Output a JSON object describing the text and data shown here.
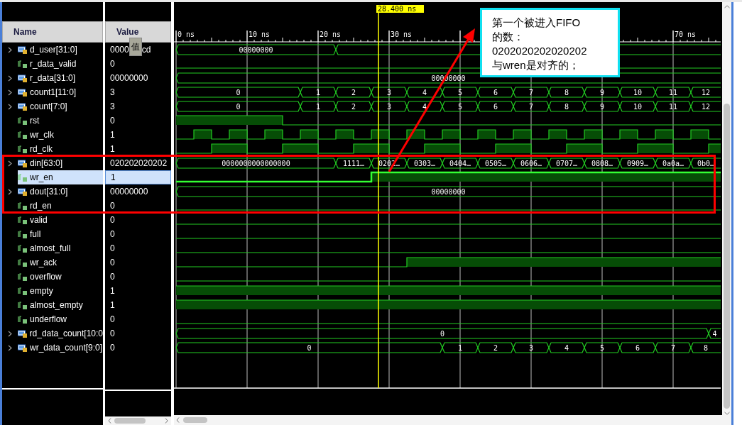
{
  "columns": [
    "Name",
    "Value"
  ],
  "cursor": {
    "label": "28.400 ns"
  },
  "ruler": [
    "0 ns",
    "10 ns",
    "20 ns",
    "30 ns",
    "70 ns"
  ],
  "signals": [
    {
      "name": "d_user[31:0]",
      "kind": "bus",
      "expandable": true,
      "selected": false,
      "value": "0000",
      "tooltip": "值",
      "value_tail": "cd",
      "values": [
        "00000000"
      ]
    },
    {
      "name": "r_data_valid",
      "kind": "bit",
      "expandable": false,
      "selected": false,
      "value": "0"
    },
    {
      "name": "r_data[31:0]",
      "kind": "bus",
      "expandable": true,
      "selected": false,
      "value": "00000000",
      "values": [
        "00000000"
      ]
    },
    {
      "name": "count1[11:0]",
      "kind": "bus",
      "expandable": true,
      "selected": false,
      "value": "3",
      "values": [
        "0",
        "1",
        "2",
        "3",
        "4",
        "5",
        "6",
        "7",
        "8",
        "9",
        "10",
        "11",
        "12"
      ]
    },
    {
      "name": "count[7:0]",
      "kind": "bus",
      "expandable": true,
      "selected": false,
      "value": "3",
      "values": [
        "0",
        "1",
        "2",
        "3",
        "4",
        "5",
        "6",
        "7",
        "8",
        "9",
        "10",
        "11",
        "12"
      ]
    },
    {
      "name": "rst",
      "kind": "bit",
      "expandable": false,
      "selected": false,
      "value": "0"
    },
    {
      "name": "wr_clk",
      "kind": "bit",
      "expandable": false,
      "selected": false,
      "value": "1"
    },
    {
      "name": "rd_clk",
      "kind": "bit",
      "expandable": false,
      "selected": false,
      "value": "1"
    },
    {
      "name": "din[63:0]",
      "kind": "bus",
      "expandable": true,
      "selected": false,
      "value": "020202020202",
      "values": [
        "0000000000000000",
        "1111…",
        "0202…",
        "0303…",
        "0404…",
        "0505…",
        "0606…",
        "0707…",
        "0808…",
        "0909…",
        "0a0a…",
        "0b0…"
      ]
    },
    {
      "name": "wr_en",
      "kind": "bit",
      "expandable": false,
      "selected": true,
      "value": "1"
    },
    {
      "name": "dout[31:0]",
      "kind": "bus",
      "expandable": true,
      "selected": false,
      "value": "00000000",
      "values": [
        "00000000"
      ]
    },
    {
      "name": "rd_en",
      "kind": "bit",
      "expandable": false,
      "selected": false,
      "value": "0"
    },
    {
      "name": "valid",
      "kind": "bit",
      "expandable": false,
      "selected": false,
      "value": "0"
    },
    {
      "name": "full",
      "kind": "bit",
      "expandable": false,
      "selected": false,
      "value": "0"
    },
    {
      "name": "almost_full",
      "kind": "bit",
      "expandable": false,
      "selected": false,
      "value": "0"
    },
    {
      "name": "wr_ack",
      "kind": "bit",
      "expandable": false,
      "selected": false,
      "value": "0"
    },
    {
      "name": "overflow",
      "kind": "bit",
      "expandable": false,
      "selected": false,
      "value": "0"
    },
    {
      "name": "empty",
      "kind": "bit",
      "expandable": false,
      "selected": false,
      "value": "1"
    },
    {
      "name": "almost_empty",
      "kind": "bit",
      "expandable": false,
      "selected": false,
      "value": "1"
    },
    {
      "name": "underflow",
      "kind": "bit",
      "expandable": false,
      "selected": false,
      "value": "0"
    },
    {
      "name": "rd_data_count[10:0",
      "kind": "bus",
      "expandable": true,
      "selected": false,
      "value": "0",
      "values": [
        "0",
        "4"
      ]
    },
    {
      "name": "wr_data_count[9:0]",
      "kind": "bus",
      "expandable": true,
      "selected": false,
      "value": "0",
      "values": [
        "0",
        "1",
        "2",
        "3",
        "4",
        "5",
        "6",
        "7",
        "8"
      ]
    }
  ],
  "callout": {
    "lines": [
      "第一个被进入FIFO",
      "的数：",
      "0202020202020202",
      "与wren是对齐的；"
    ]
  }
}
